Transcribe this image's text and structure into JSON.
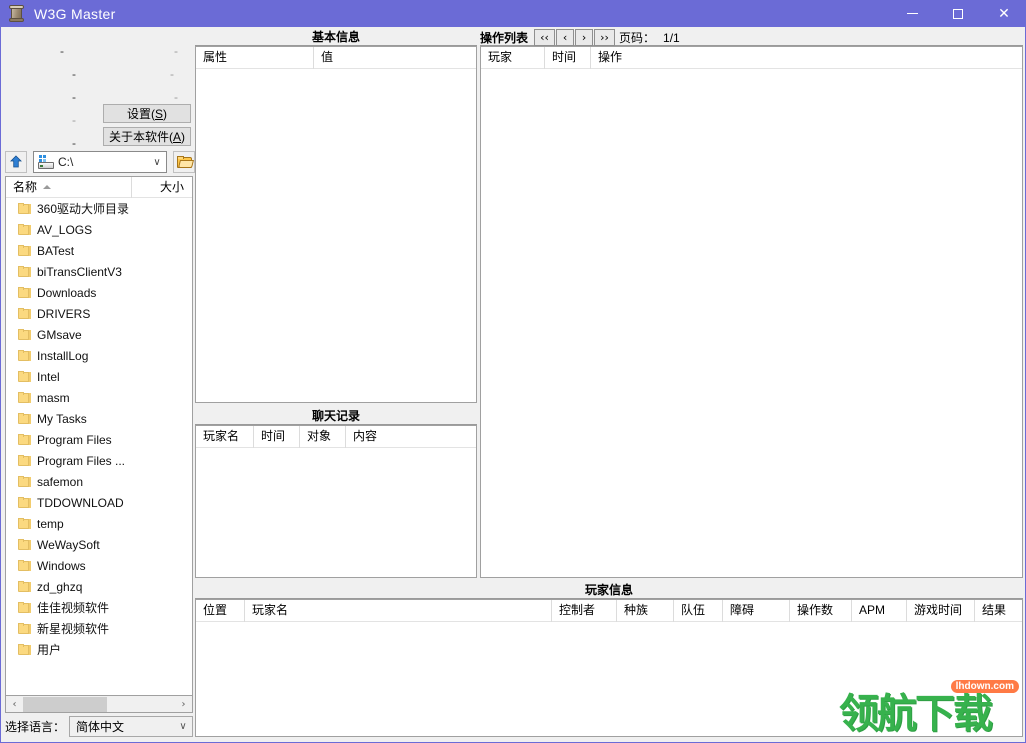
{
  "window": {
    "title": "W3G Master",
    "icon": "scroll-icon",
    "accent_color": "#6b6bd6",
    "controls": {
      "minimize": "—",
      "maximize": "□",
      "close": "✕"
    }
  },
  "left_panel": {
    "placeholder_dashes": [
      "-",
      "-",
      "-",
      "-",
      "-",
      "-",
      "-",
      "-"
    ],
    "settings_button": {
      "label": "设置",
      "accel": "S"
    },
    "about_button": {
      "label": "关于本软件",
      "accel": "A"
    }
  },
  "path_bar": {
    "up_button_icon": "up-arrow-icon",
    "drive_icon": "drive-icon",
    "current_path": "C:\\",
    "dropdown_caret": "∨",
    "browse_button_icon": "folder-open-icon"
  },
  "file_list": {
    "columns": [
      "名称",
      "大小"
    ],
    "sort_indicator": "ascending",
    "items": [
      {
        "name": "360驱动大师目录",
        "type": "folder",
        "size": ""
      },
      {
        "name": "AV_LOGS",
        "type": "folder",
        "size": ""
      },
      {
        "name": "BATest",
        "type": "folder",
        "size": ""
      },
      {
        "name": "biTransClientV3",
        "type": "folder",
        "size": ""
      },
      {
        "name": "Downloads",
        "type": "folder",
        "size": ""
      },
      {
        "name": "DRIVERS",
        "type": "folder",
        "size": ""
      },
      {
        "name": "GMsave",
        "type": "folder",
        "size": ""
      },
      {
        "name": "InstallLog",
        "type": "folder",
        "size": ""
      },
      {
        "name": "Intel",
        "type": "folder",
        "size": ""
      },
      {
        "name": "masm",
        "type": "folder",
        "size": ""
      },
      {
        "name": "My Tasks",
        "type": "folder",
        "size": ""
      },
      {
        "name": "Program Files",
        "type": "folder",
        "size": ""
      },
      {
        "name": "Program Files ...",
        "type": "folder",
        "size": ""
      },
      {
        "name": "safemon",
        "type": "folder",
        "size": ""
      },
      {
        "name": "TDDOWNLOAD",
        "type": "folder",
        "size": ""
      },
      {
        "name": "temp",
        "type": "folder",
        "size": ""
      },
      {
        "name": "WeWaySoft",
        "type": "folder",
        "size": ""
      },
      {
        "name": "Windows",
        "type": "folder",
        "size": ""
      },
      {
        "name": "zd_ghzq",
        "type": "folder",
        "size": ""
      },
      {
        "name": "佳佳视频软件",
        "type": "folder",
        "size": ""
      },
      {
        "name": "新星视频软件",
        "type": "folder",
        "size": ""
      },
      {
        "name": "用户",
        "type": "folder",
        "size": ""
      }
    ],
    "scroll": {
      "left_arrow": "‹",
      "right_arrow": "›"
    }
  },
  "language": {
    "label": "选择语言：",
    "value": "简体中文",
    "caret": "∨"
  },
  "basic_info": {
    "caption": "基本信息",
    "columns": [
      "属性",
      "值"
    ],
    "rows": []
  },
  "chat_log": {
    "caption": "聊天记录",
    "columns": [
      "玩家名",
      "时间",
      "对象",
      "内容"
    ],
    "rows": []
  },
  "action_list": {
    "caption": "操作列表",
    "nav": {
      "first": "‹‹",
      "prev": "‹",
      "next": "›",
      "last": "››"
    },
    "page_label": "页码：",
    "page_value": "1/1",
    "columns": [
      "玩家",
      "时间",
      "操作"
    ],
    "rows": []
  },
  "player_info": {
    "caption": "玩家信息",
    "columns": [
      "位置",
      "玩家名",
      "控制者",
      "种族",
      "队伍",
      "障碍",
      "操作数",
      "APM",
      "游戏时间",
      "结果"
    ],
    "rows": []
  },
  "watermark": {
    "text": "领航下载",
    "badge": "lhdown.com",
    "color": "#37b24d",
    "badge_color": "#ff7a45"
  }
}
